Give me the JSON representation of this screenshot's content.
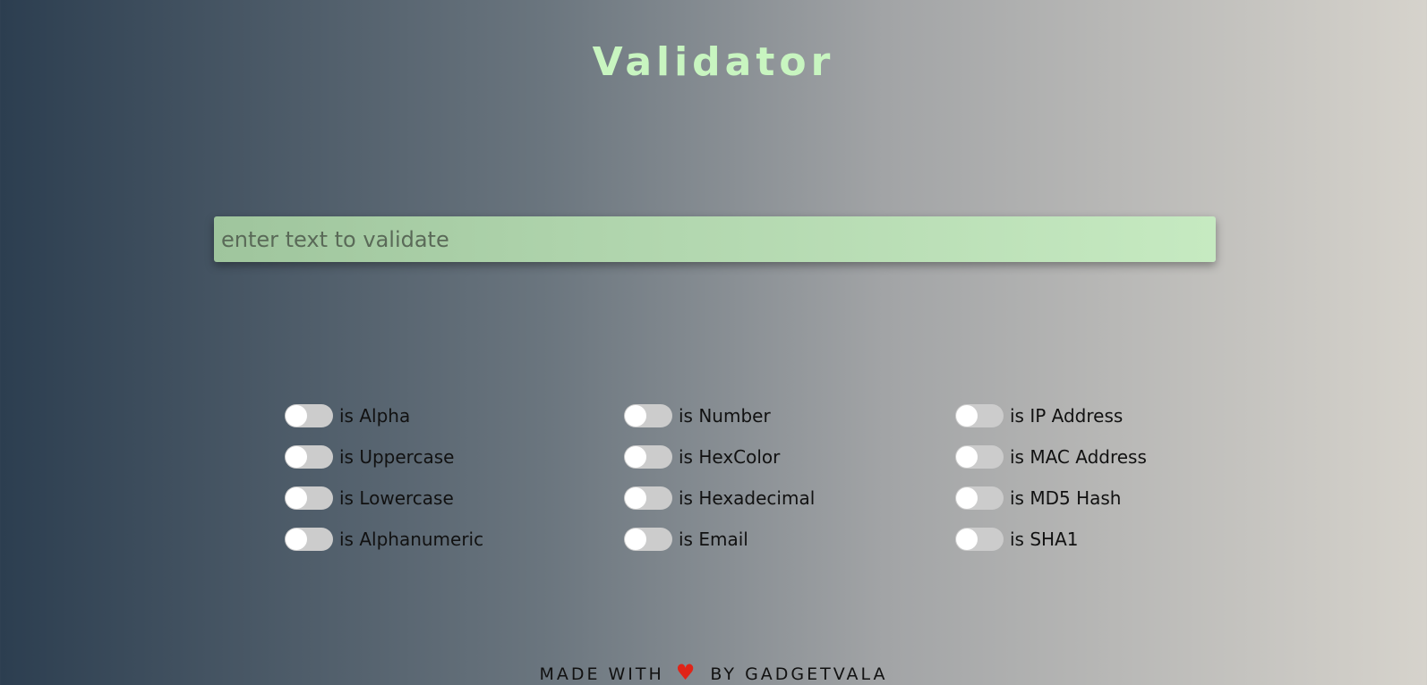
{
  "header": {
    "title": "Validator"
  },
  "input": {
    "placeholder": "enter text to validate",
    "value": ""
  },
  "validators": {
    "col1": [
      {
        "label": "is Alpha",
        "enabled": false
      },
      {
        "label": "is Uppercase",
        "enabled": false
      },
      {
        "label": "is Lowercase",
        "enabled": false
      },
      {
        "label": "is Alphanumeric",
        "enabled": false
      }
    ],
    "col2": [
      {
        "label": "is Number",
        "enabled": false
      },
      {
        "label": "is HexColor",
        "enabled": false
      },
      {
        "label": "is Hexadecimal",
        "enabled": false
      },
      {
        "label": "is Email",
        "enabled": false
      }
    ],
    "col3": [
      {
        "label": "is IP Address",
        "enabled": false
      },
      {
        "label": "is MAC Address",
        "enabled": false
      },
      {
        "label": "is MD5 Hash",
        "enabled": false
      },
      {
        "label": "is SHA1",
        "enabled": false
      }
    ]
  },
  "footer": {
    "prefix": "MADE WITH",
    "heart_icon": "heart-icon",
    "suffix": "BY GADGETVALA"
  },
  "colors": {
    "title": "#c8f5c0",
    "input_background": "#b0d5ad",
    "toggle_off": "#cccccc",
    "heart": "#e02418"
  }
}
